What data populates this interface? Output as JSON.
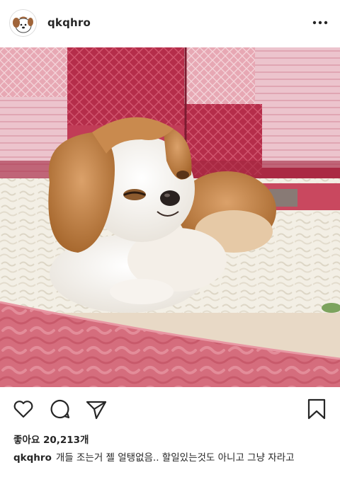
{
  "header": {
    "username": "qkqhro",
    "avatar_icon": "cartoon-dog-avatar-icon",
    "more_icon": "more-options-icon"
  },
  "photo": {
    "subject": "shih-tzu-dog-lying-on-quilt"
  },
  "actions": {
    "icons": [
      "heart-icon",
      "comment-icon",
      "share-icon",
      "bookmark-icon"
    ]
  },
  "likes": {
    "text": "좋아요 20,213개"
  },
  "caption": {
    "username": "qkqhro",
    "text": "개들 조는거 젤 얼탱없음.. 할일있는것도 아니고 그냥 자라고"
  },
  "colors": {
    "text": "#262626",
    "quilt_red": "#b8324d",
    "blanket_pink": "#d9707f",
    "dog_fur": "#c98a4e"
  }
}
